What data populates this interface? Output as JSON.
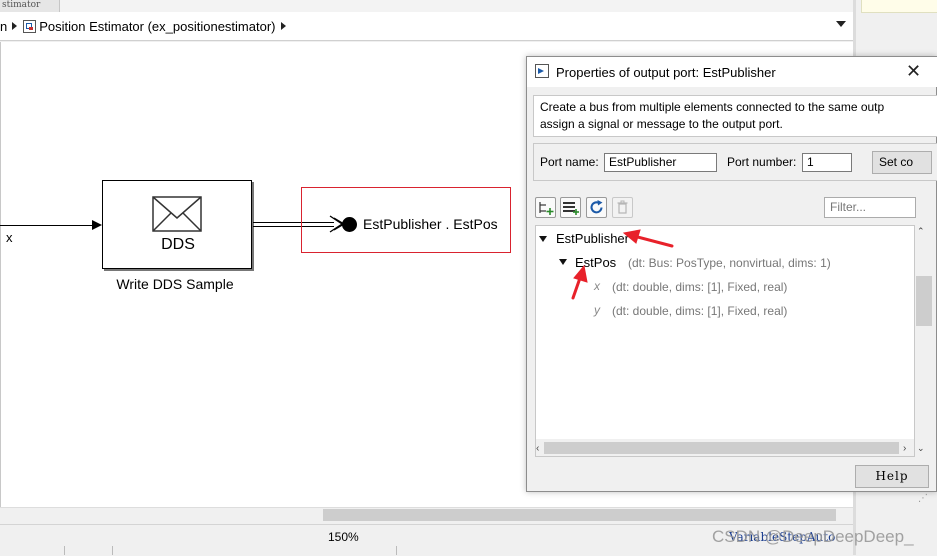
{
  "window": {
    "top_tab_title": "stimator",
    "breadcrumb": {
      "root_fragment": "n",
      "current": "Position Estimator (ex_positionestimator)"
    }
  },
  "canvas": {
    "signal_label": "x",
    "dds_block": {
      "label": "DDS",
      "caption": "Write DDS Sample",
      "icon": "envelope-icon"
    },
    "output_port": {
      "name": "EstPublisher . EstPos",
      "highlight_color": "#d9232f"
    }
  },
  "status_bar": {
    "zoom": "150%",
    "solver": "VariableStepAuto"
  },
  "dialog": {
    "title": "Properties of output port: EstPublisher",
    "close_icon": "close-icon",
    "description": {
      "line1": "Create a bus from multiple elements connected to the same outp",
      "line2": "assign a signal or message to the output port."
    },
    "port_name_label": "Port name:",
    "port_name_value": "EstPublisher",
    "port_number_label": "Port number:",
    "port_number_value": "1",
    "set_button_label": "Set co",
    "toolbar_icons": [
      "add-element-icon",
      "add-from-bus-icon",
      "refresh-icon",
      "delete-icon"
    ],
    "filter_placeholder": "Filter...",
    "tree": {
      "root": "EstPublisher",
      "child": {
        "name": "EstPos",
        "meta": "(dt: Bus: PosType, nonvirtual, dims: 1)"
      },
      "fields": [
        {
          "name": "x",
          "meta": "(dt: double, dims: [1], Fixed, real)"
        },
        {
          "name": "y",
          "meta": "(dt: double, dims: [1], Fixed, real)"
        }
      ]
    },
    "help_label": "Help"
  },
  "annotations": {
    "arrow_color": "#e8212a"
  },
  "watermark": "CSDN @DeepDeepDeep_"
}
